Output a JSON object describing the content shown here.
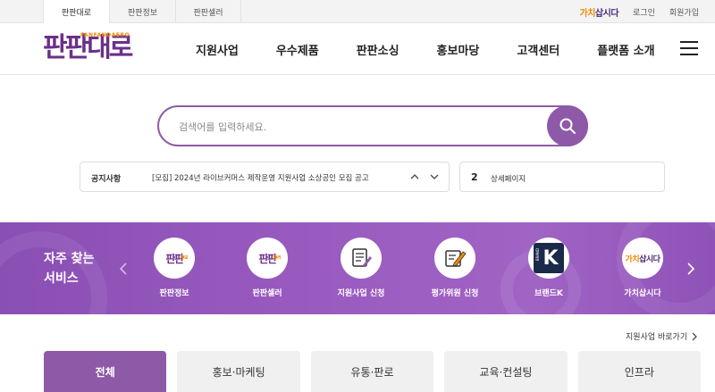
{
  "topbar": {
    "tabs": [
      "판판대로",
      "판판정보",
      "판판셀러"
    ],
    "gachi_logo": {
      "part1": "가치",
      "part2": "삽시다"
    },
    "login": "로그인",
    "signup": "회원가입"
  },
  "header": {
    "brand": {
      "main": "판판대로",
      "sub": "FANFANDAERO"
    },
    "nav": [
      "지원사업",
      "우수제품",
      "판판소싱",
      "홍보마당",
      "고객센터",
      "플랫폼 소개"
    ]
  },
  "search": {
    "placeholder": "검색어를 입력하세요."
  },
  "notice": {
    "label": "공지사항",
    "text": "[모집] 2024년 라이브커머스 제작운영 지원사업 소상공인 모집 공고"
  },
  "counter": {
    "value": "2",
    "label": "상세페이지"
  },
  "services": {
    "title_line1": "자주 찾는",
    "title_line2": "서비스",
    "items": [
      {
        "name": "판판정보",
        "icon": "fanfan-info-logo",
        "logo_main": "판판",
        "logo_sub": "정보"
      },
      {
        "name": "판판셀러",
        "icon": "fanfan-seller-logo",
        "logo_main": "판판",
        "logo_sub": "셀러"
      },
      {
        "name": "지원사업 신청",
        "icon": "document-apply-icon"
      },
      {
        "name": "평가위원 신청",
        "icon": "edit-pencil-icon"
      },
      {
        "name": "브랜드K",
        "icon": "brand-k-logo",
        "logo_text": "K",
        "logo_side": "BRAND"
      },
      {
        "name": "가치삽시다",
        "icon": "gachi-logo",
        "logo_main": "가치",
        "logo_sub": "삽시다"
      }
    ]
  },
  "shortcut": {
    "label": "지원사업 바로가기"
  },
  "categories": [
    "전체",
    "홍보·마케팅",
    "유통·판로",
    "교육·컨설팅",
    "인프라"
  ],
  "colors": {
    "brand_purple": "#8e5aa8",
    "logo_purple": "#6b2f8a",
    "accent_orange": "#f08a00"
  }
}
